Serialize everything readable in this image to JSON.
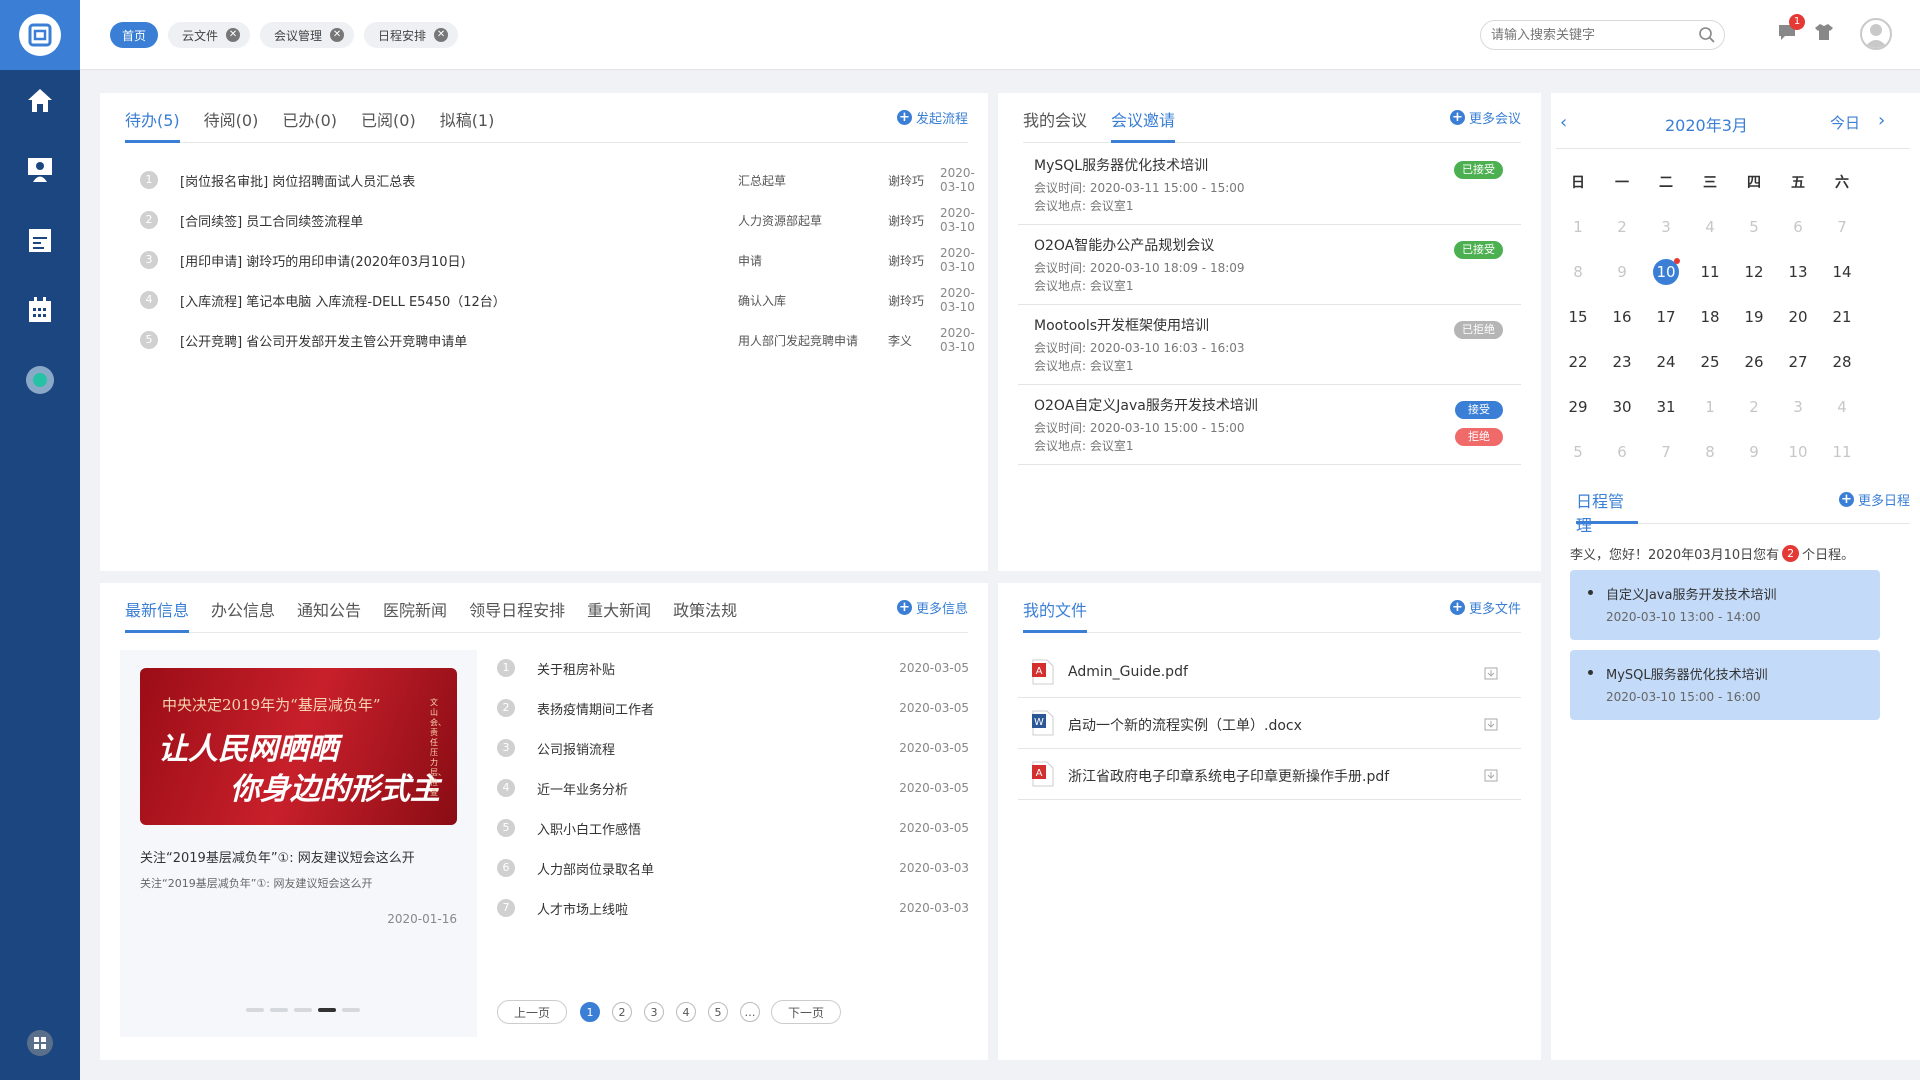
{
  "header": {
    "tabs": [
      {
        "label": "首页",
        "active": true
      },
      {
        "label": "云文件"
      },
      {
        "label": "会议管理"
      },
      {
        "label": "日程安排"
      }
    ],
    "search_placeholder": "请输入搜索关键字",
    "message_count": "1"
  },
  "todo": {
    "tabs": [
      "待办(5)",
      "待阅(0)",
      "已办(0)",
      "已阅(0)",
      "拟稿(1)"
    ],
    "action": "发起流程",
    "rows": [
      {
        "n": "1",
        "title": "[岗位报名审批] 岗位招聘面试人员汇总表",
        "step": "汇总起草",
        "person": "谢玲巧",
        "date": "2020-03-10"
      },
      {
        "n": "2",
        "title": "[合同续签] 员工合同续签流程单",
        "step": "人力资源部起草",
        "person": "谢玲巧",
        "date": "2020-03-10"
      },
      {
        "n": "3",
        "title": "[用印申请] 谢玲巧的用印申请(2020年03月10日)",
        "step": "申请",
        "person": "谢玲巧",
        "date": "2020-03-10"
      },
      {
        "n": "4",
        "title": "[入库流程] 笔记本电脑 入库流程-DELL E5450（12台）",
        "step": "确认入库",
        "person": "谢玲巧",
        "date": "2020-03-10"
      },
      {
        "n": "5",
        "title": "[公开竞聘] 省公司开发部开发主管公开竞聘申请单",
        "step": "用人部门发起竞聘申请",
        "person": "李义",
        "date": "2020-03-10"
      }
    ]
  },
  "meetings": {
    "tabs": [
      "我的会议",
      "会议邀请"
    ],
    "action": "更多会议",
    "items": [
      {
        "title": "MySQL服务器优化技术培训",
        "time": "会议时间: 2020-03-11 15:00 - 15:00",
        "place": "会议地点: 会议室1",
        "status": "已接受",
        "color": "#4caf50"
      },
      {
        "title": "O2OA智能办公产品规划会议",
        "time": "会议时间: 2020-03-10 18:09 - 18:09",
        "place": "会议地点: 会议室1",
        "status": "已接受",
        "color": "#4caf50"
      },
      {
        "title": "Mootools开发框架使用培训",
        "time": "会议时间: 2020-03-10 16:03 - 16:03",
        "place": "会议地点: 会议室1",
        "status": "已拒绝",
        "color": "#b5b5b5"
      },
      {
        "title": "O2OA自定义Java服务开发技术培训",
        "time": "会议时间: 2020-03-10 15:00 - 15:00",
        "place": "会议地点: 会议室1",
        "accept": "接受",
        "reject": "拒绝",
        "accept_color": "#3a7fd5",
        "reject_color": "#f06a6a"
      }
    ]
  },
  "calendar": {
    "month": "2020年3月",
    "today_label": "今日",
    "weekdays": [
      "日",
      "一",
      "二",
      "三",
      "四",
      "五",
      "六"
    ],
    "weeks": [
      [
        "1",
        "2",
        "3",
        "4",
        "5",
        "6",
        "7"
      ],
      [
        "8",
        "9",
        "10",
        "11",
        "12",
        "13",
        "14"
      ],
      [
        "15",
        "16",
        "17",
        "18",
        "19",
        "20",
        "21"
      ],
      [
        "22",
        "23",
        "24",
        "25",
        "26",
        "27",
        "28"
      ],
      [
        "29",
        "30",
        "31",
        "1",
        "2",
        "3",
        "4"
      ],
      [
        "5",
        "6",
        "7",
        "8",
        "9",
        "10",
        "11"
      ]
    ],
    "today": "10"
  },
  "schedule": {
    "title": "日程管理",
    "action": "更多日程",
    "greeting_pre": "李义，您好！2020年03月10日您有",
    "count": "2",
    "greeting_post": "个日程。",
    "items": [
      {
        "title": "自定义Java服务开发技术培训",
        "time": "2020-03-10 13:00 - 14:00"
      },
      {
        "title": "MySQL服务器优化技术培训",
        "time": "2020-03-10 15:00 - 16:00"
      }
    ]
  },
  "news": {
    "tabs": [
      "最新信息",
      "办公信息",
      "通知公告",
      "医院新闻",
      "领导日程安排",
      "重大新闻",
      "政策法规"
    ],
    "action": "更多信息",
    "banner": {
      "line1": "中央决定2019年为“基层减负年”",
      "line2": "让人民网晒晒",
      "line3": "你身边的形式主",
      "side": "文山会、责任压力层、检查"
    },
    "feature_title": "关注“2019基层减负年”①: 网友建议短会这么开",
    "feature_sub": "关注“2019基层减负年”①: 网友建议短会这么开",
    "feature_date": "2020-01-16",
    "rows": [
      {
        "n": "1",
        "title": "关于租房补贴",
        "date": "2020-03-05"
      },
      {
        "n": "2",
        "title": "表扬疫情期间工作者",
        "date": "2020-03-05"
      },
      {
        "n": "3",
        "title": "公司报销流程",
        "date": "2020-03-05"
      },
      {
        "n": "4",
        "title": "近一年业务分析",
        "date": "2020-03-05"
      },
      {
        "n": "5",
        "title": "入职小白工作感悟",
        "date": "2020-03-05"
      },
      {
        "n": "6",
        "title": "人力部岗位录取名单",
        "date": "2020-03-03"
      },
      {
        "n": "7",
        "title": "人才市场上线啦",
        "date": "2020-03-03"
      }
    ],
    "pager": {
      "prev": "上一页",
      "next": "下一页",
      "pages": [
        "1",
        "2",
        "3",
        "4",
        "5",
        "…"
      ],
      "current": "1"
    }
  },
  "files": {
    "tab": "我的文件",
    "action": "更多文件",
    "items": [
      {
        "name": "Admin_Guide.pdf",
        "type": "pdf"
      },
      {
        "name": "启动一个新的流程实例（工单）.docx",
        "type": "docx"
      },
      {
        "name": "浙江省政府电子印章系统电子印章更新操作手册.pdf",
        "type": "pdf"
      }
    ]
  },
  "colors": {
    "accent": "#3a7fd5",
    "sidebar": "#1b467f"
  }
}
